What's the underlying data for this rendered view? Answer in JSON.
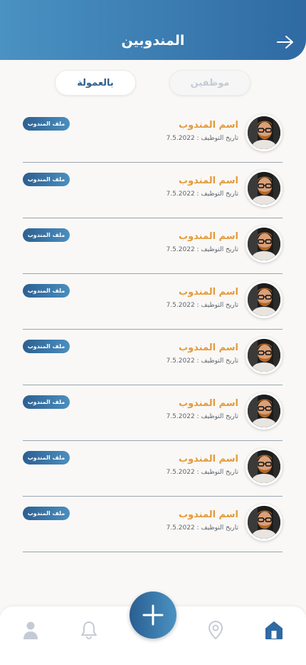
{
  "header": {
    "title": "المندوبين"
  },
  "tabs": {
    "commission_label": "بالعمولة",
    "employees_label": "موظفين",
    "active": "commission"
  },
  "reps": [
    {
      "name": "اسم المندوب",
      "date": "تاريخ التوظيف : 7.5.2022",
      "button": "ملف المندوب"
    },
    {
      "name": "اسم المندوب",
      "date": "تاريخ التوظيف : 7.5.2022",
      "button": "ملف المندوب"
    },
    {
      "name": "اسم المندوب",
      "date": "تاريخ التوظيف : 7.5.2022",
      "button": "ملف المندوب"
    },
    {
      "name": "اسم المندوب",
      "date": "تاريخ التوظيف : 7.5.2022",
      "button": "ملف المندوب"
    },
    {
      "name": "اسم المندوب",
      "date": "تاريخ التوظيف : 7.5.2022",
      "button": "ملف المندوب"
    },
    {
      "name": "اسم المندوب",
      "date": "تاريخ التوظيف : 7.5.2022",
      "button": "ملف المندوب"
    },
    {
      "name": "اسم المندوب",
      "date": "تاريخ التوظيف : 7.5.2022",
      "button": "ملف المندوب"
    },
    {
      "name": "اسم المندوب",
      "date": "تاريخ التوظيف : 7.5.2022",
      "button": "ملف المندوب"
    }
  ],
  "bottom_nav": {
    "items": [
      "profile-icon",
      "bell-icon",
      "add-icon",
      "location-icon",
      "home-icon"
    ],
    "active": "home-icon"
  },
  "colors": {
    "primary": "#2f6aa3",
    "accent": "#e59a3a",
    "inactive": "#c5cbd6"
  }
}
